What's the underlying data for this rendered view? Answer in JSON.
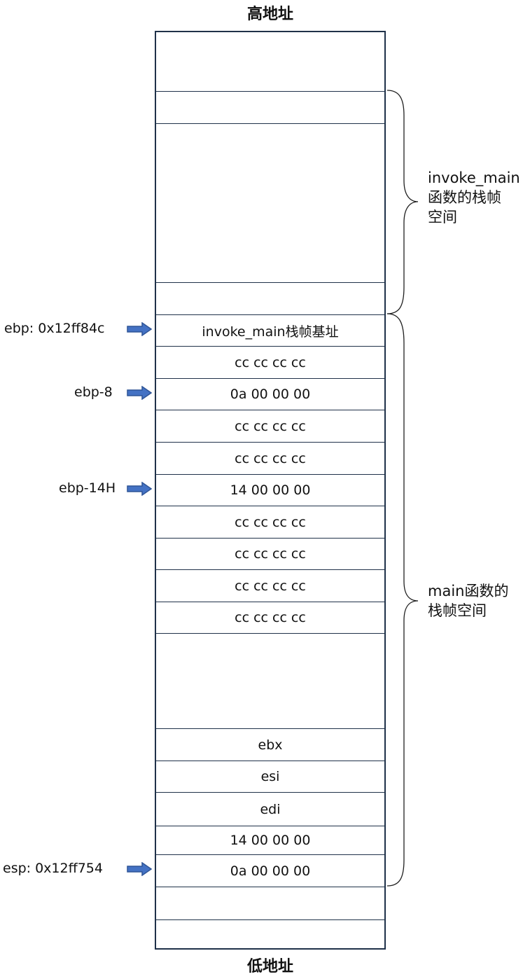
{
  "titles": {
    "top": "高地址",
    "bottom": "低地址"
  },
  "stack_cells": [
    "",
    "",
    "",
    "",
    "invoke_main栈帧基址",
    "cc cc cc cc",
    "0a 00 00 00",
    "cc cc cc cc",
    "cc cc cc cc",
    "14 00 00 00",
    "cc cc cc cc",
    "cc cc cc cc",
    "cc cc cc cc",
    "cc cc cc cc",
    "",
    "ebx",
    "esi",
    "edi",
    "14 00 00 00",
    "0a 00 00 00",
    "",
    ""
  ],
  "pointers": [
    {
      "label": "ebp: 0x12ff84c"
    },
    {
      "label": "ebp-8"
    },
    {
      "label": "ebp-14H"
    },
    {
      "label": "esp: 0x12ff754"
    }
  ],
  "braces": [
    {
      "lines": [
        "invoke_main",
        "函数的栈帧",
        "空间"
      ]
    },
    {
      "lines": [
        "main函数的",
        "栈帧空间"
      ]
    }
  ],
  "colors": {
    "arrow_fill": "#4472c4",
    "arrow_stroke": "#2f5597",
    "box_border": "#1f3149"
  }
}
